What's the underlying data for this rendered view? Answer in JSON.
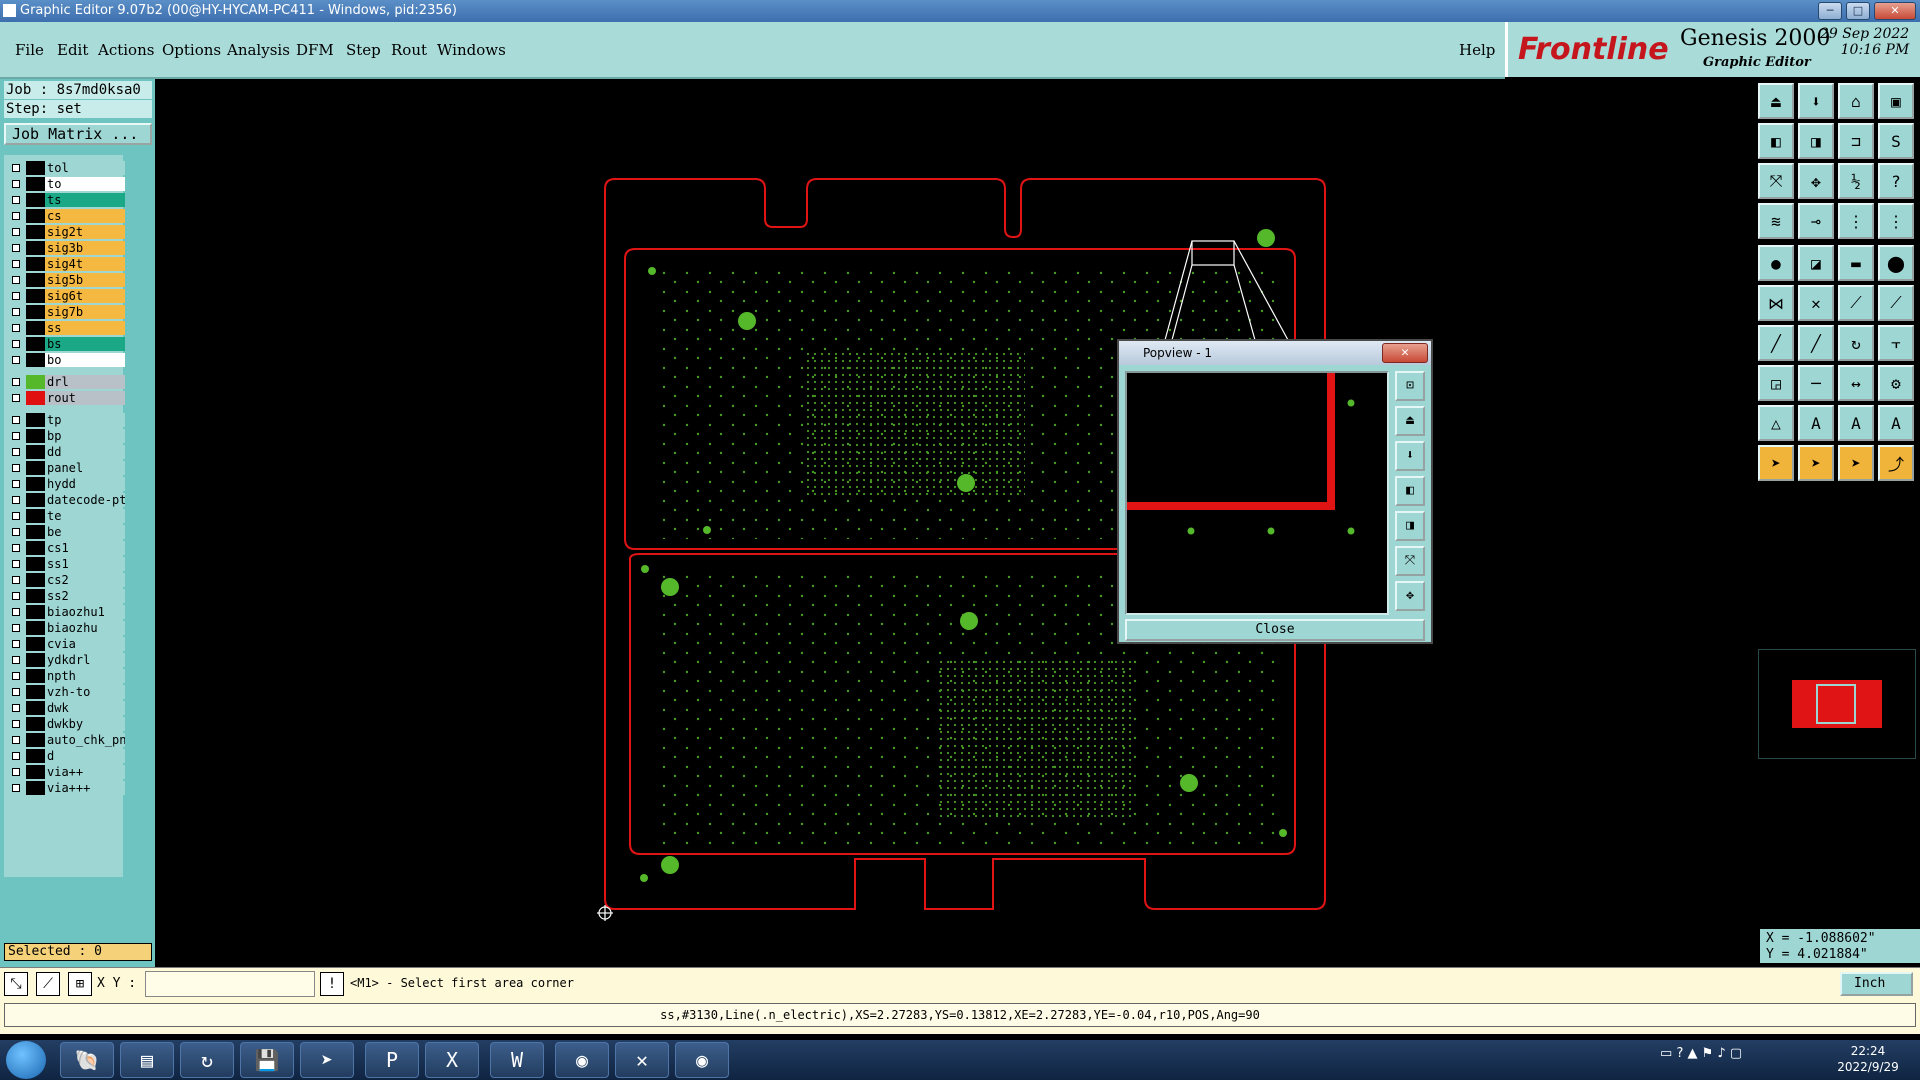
{
  "window": {
    "title": "Graphic Editor 9.07b2 (00@HY-HYCAM-PC411 - Windows, pid:2356)",
    "minimize": "─",
    "maximize": "□",
    "close": "✕"
  },
  "menu": {
    "items": [
      "File",
      "Edit",
      "Actions",
      "Options",
      "Analysis",
      "DFM",
      "Step",
      "Rout",
      "Windows"
    ],
    "help": "Help"
  },
  "brand": {
    "logo": "Frontline",
    "product": "Genesis 2000",
    "subtitle": "Graphic Editor",
    "date": "29 Sep 2022",
    "time": "10:16 PM"
  },
  "job": {
    "job_line": "Job : 8s7md0ksa0",
    "step_line": "Step: set",
    "matrix_button": "Job Matrix ..."
  },
  "layers": [
    {
      "name": "tol",
      "bg": "#9ed6d3",
      "swatch": "#000000"
    },
    {
      "name": "to",
      "bg": "#ffffff",
      "swatch": "#000000"
    },
    {
      "name": "ts",
      "bg": "#1aa886",
      "swatch": "#000000"
    },
    {
      "name": "cs",
      "bg": "#f5b841",
      "swatch": "#000000"
    },
    {
      "name": "sig2t",
      "bg": "#f5b841",
      "swatch": "#000000"
    },
    {
      "name": "sig3b",
      "bg": "#f5b841",
      "swatch": "#000000"
    },
    {
      "name": "sig4t",
      "bg": "#f5b841",
      "swatch": "#000000"
    },
    {
      "name": "sig5b",
      "bg": "#f5b841",
      "swatch": "#000000"
    },
    {
      "name": "sig6t",
      "bg": "#f5b841",
      "swatch": "#000000"
    },
    {
      "name": "sig7b",
      "bg": "#f5b841",
      "swatch": "#000000"
    },
    {
      "name": "ss",
      "bg": "#f5b841",
      "swatch": "#000000"
    },
    {
      "name": "bs",
      "bg": "#1aa886",
      "swatch": "#000000"
    },
    {
      "name": "bo",
      "bg": "#ffffff",
      "swatch": "#000000"
    },
    {
      "name": "drl",
      "bg": "#b8c0c8",
      "swatch": "#55b82a"
    },
    {
      "name": "rout",
      "bg": "#b8c0c8",
      "swatch": "#e01010"
    },
    {
      "name": "tp",
      "bg": "#9ed6d3",
      "swatch": "#000000"
    },
    {
      "name": "bp",
      "bg": "#9ed6d3",
      "swatch": "#000000"
    },
    {
      "name": "dd",
      "bg": "#9ed6d3",
      "swatch": "#000000"
    },
    {
      "name": "panel",
      "bg": "#9ed6d3",
      "swatch": "#000000"
    },
    {
      "name": "hydd",
      "bg": "#9ed6d3",
      "swatch": "#000000"
    },
    {
      "name": "datecode-pt",
      "bg": "#9ed6d3",
      "swatch": "#000000"
    },
    {
      "name": "te",
      "bg": "#9ed6d3",
      "swatch": "#000000"
    },
    {
      "name": "be",
      "bg": "#9ed6d3",
      "swatch": "#000000"
    },
    {
      "name": "cs1",
      "bg": "#9ed6d3",
      "swatch": "#000000"
    },
    {
      "name": "ss1",
      "bg": "#9ed6d3",
      "swatch": "#000000"
    },
    {
      "name": "cs2",
      "bg": "#9ed6d3",
      "swatch": "#000000"
    },
    {
      "name": "ss2",
      "bg": "#9ed6d3",
      "swatch": "#000000"
    },
    {
      "name": "biaozhu1",
      "bg": "#9ed6d3",
      "swatch": "#000000"
    },
    {
      "name": "biaozhu",
      "bg": "#9ed6d3",
      "swatch": "#000000"
    },
    {
      "name": "cvia",
      "bg": "#9ed6d3",
      "swatch": "#000000"
    },
    {
      "name": "ydkdrl",
      "bg": "#9ed6d3",
      "swatch": "#000000"
    },
    {
      "name": "npth",
      "bg": "#9ed6d3",
      "swatch": "#000000"
    },
    {
      "name": "vzh-to",
      "bg": "#9ed6d3",
      "swatch": "#000000"
    },
    {
      "name": "dwk",
      "bg": "#9ed6d3",
      "swatch": "#000000"
    },
    {
      "name": "dwkby",
      "bg": "#9ed6d3",
      "swatch": "#000000"
    },
    {
      "name": "auto_chk_pn",
      "bg": "#9ed6d3",
      "swatch": "#000000"
    },
    {
      "name": "d",
      "bg": "#9ed6d3",
      "swatch": "#000000"
    },
    {
      "name": "via++",
      "bg": "#9ed6d3",
      "swatch": "#000000"
    },
    {
      "name": "via+++",
      "bg": "#9ed6d3",
      "swatch": "#000000"
    }
  ],
  "selected": "Selected : 0",
  "popview": {
    "title": "Popview - 1",
    "close_button": "Close"
  },
  "coords": {
    "x": "X = -1.088602\"",
    "y": "Y = 4.021884\""
  },
  "command": {
    "xy_label": "X Y :",
    "xy_value": "",
    "message": "<M1> - Select first area corner",
    "unit": "Inch"
  },
  "status": "ss,#3130,Line(.n_electric),XS=2.27283,YS=0.13812,XE=2.27283,YE=-0.04,r10,POS,Ang=90",
  "taskbar": {
    "time": "22:24",
    "date": "2022/9/29"
  }
}
